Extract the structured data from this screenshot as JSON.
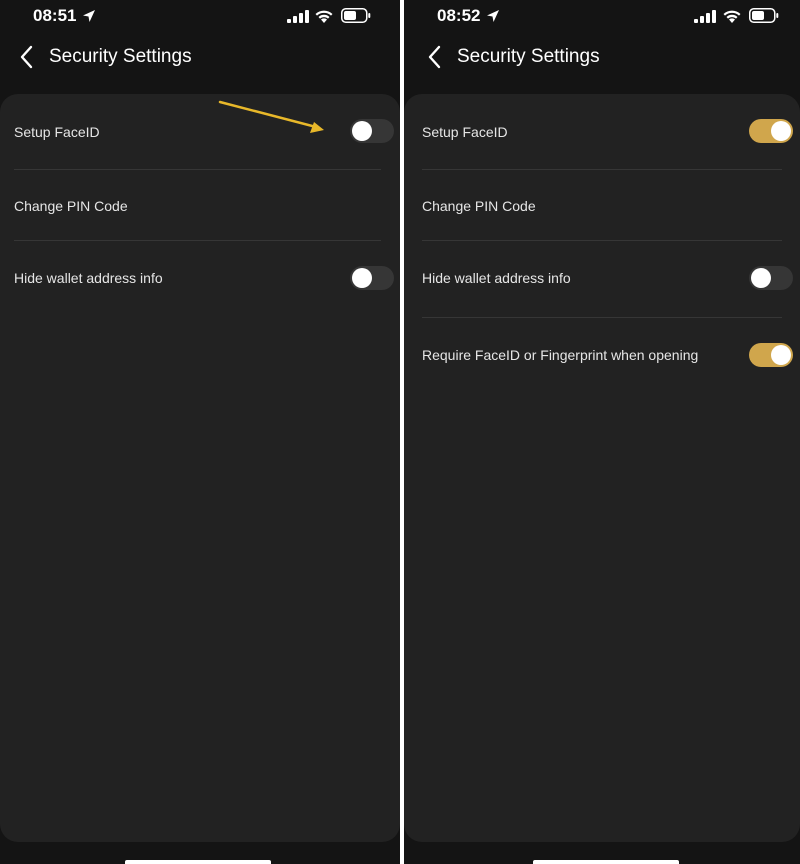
{
  "colors": {
    "background": "#141414",
    "card": "#222222",
    "toggle_on": "#d0a64c",
    "toggle_off": "#363636",
    "annotation_arrow": "#e8b82a"
  },
  "screens": {
    "left": {
      "status": {
        "time": "08:51",
        "icons": [
          "location-icon",
          "signal-icon",
          "wifi-icon",
          "battery-icon"
        ]
      },
      "nav": {
        "back_icon": "chevron-left-icon",
        "title": "Security Settings"
      },
      "rows": [
        {
          "label": "Setup FaceID",
          "toggle": "off"
        },
        {
          "label": "Change PIN Code"
        },
        {
          "label": "Hide wallet address info",
          "toggle": "off"
        }
      ]
    },
    "right": {
      "status": {
        "time": "08:52",
        "icons": [
          "location-icon",
          "signal-icon",
          "wifi-icon",
          "battery-icon"
        ]
      },
      "nav": {
        "back_icon": "chevron-left-icon",
        "title": "Security Settings"
      },
      "rows": [
        {
          "label": "Setup FaceID",
          "toggle": "on"
        },
        {
          "label": "Change PIN Code"
        },
        {
          "label": "Hide wallet address info",
          "toggle": "off"
        },
        {
          "label": "Require FaceID or Fingerprint when opening",
          "toggle": "on"
        }
      ]
    }
  }
}
